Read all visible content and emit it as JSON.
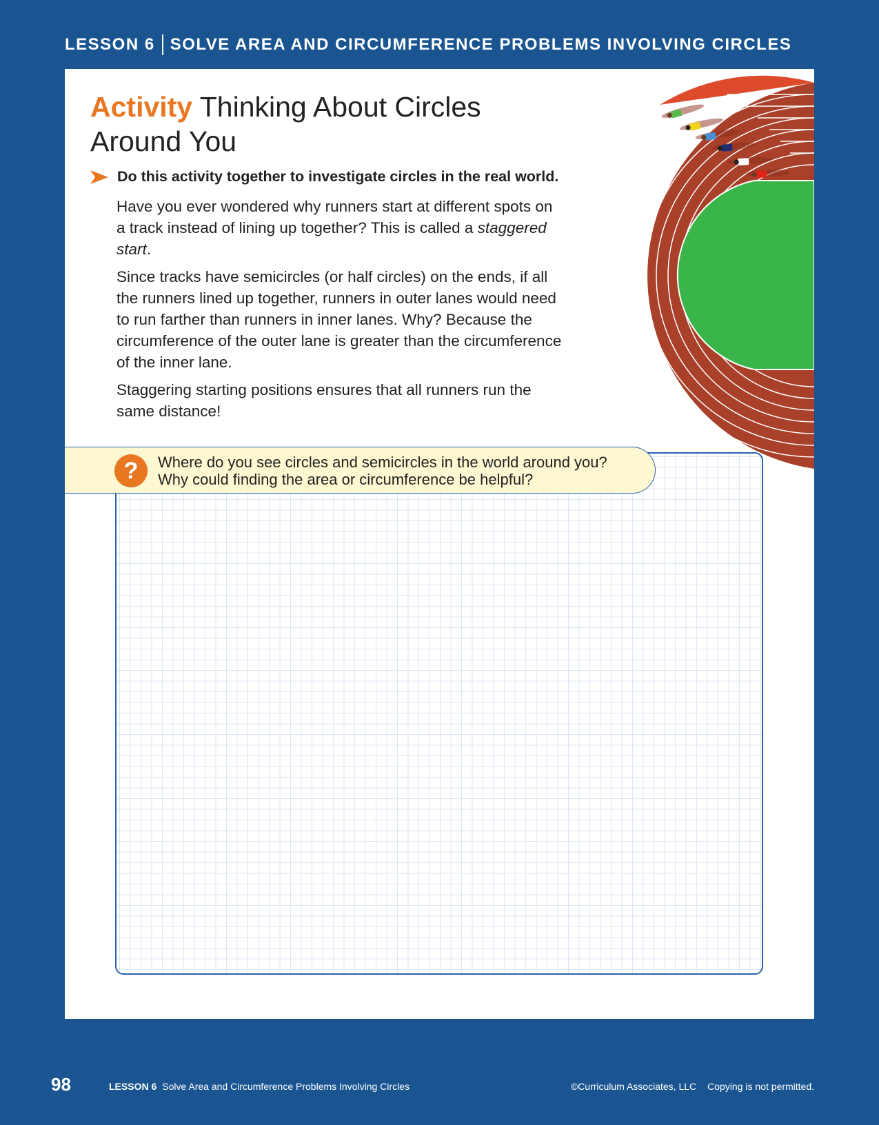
{
  "header": {
    "lesson": "LESSON 6",
    "title": "SOLVE AREA AND CIRCUMFERENCE PROBLEMS INVOLVING CIRCLES"
  },
  "activity": {
    "label": "Activity",
    "title_line1": "Thinking About Circles",
    "title_line2": "Around You"
  },
  "instruction": "Do this activity together to investigate circles in the real world.",
  "paragraphs": {
    "p1_before": "Have you ever wondered why runners start at different spots on a track instead of lining up together? This is called a ",
    "p1_em": "staggered start",
    "p1_after": ".",
    "p2": "Since tracks have semicircles (or half circles) on the ends, if all the runners lined up together, runners in outer lanes would need to run farther than runners in inner lanes. Why? Because the circumference of the outer lane is greater than the circumference of the inner lane.",
    "p3": "Staggering starting positions ensures that all runners run the same distance!"
  },
  "question": {
    "icon": "?",
    "line1": "Where do you see circles and semicircles in the world around you?",
    "line2": "Why could finding the area or circumference be helpful?"
  },
  "footer": {
    "page_number": "98",
    "lesson": "LESSON 6",
    "lesson_title": "Solve Area and Circumference Problems Involving Circles",
    "copyright": "©Curriculum Associates, LLC",
    "notice": "Copying is not permitted."
  },
  "colors": {
    "page_background": "#1a5591",
    "accent_orange": "#e87722",
    "track_brown": "#a8402a",
    "track_red": "#de4a2c",
    "field_green": "#3ab54a",
    "prompt_yellow": "#fdf8d2",
    "grid_border": "#2a62ac"
  },
  "runner_colors": [
    "#5bb84d",
    "#f2d21b",
    "#4a8fd4",
    "#1f2d6e",
    "#ffffff",
    "#e2231a"
  ]
}
